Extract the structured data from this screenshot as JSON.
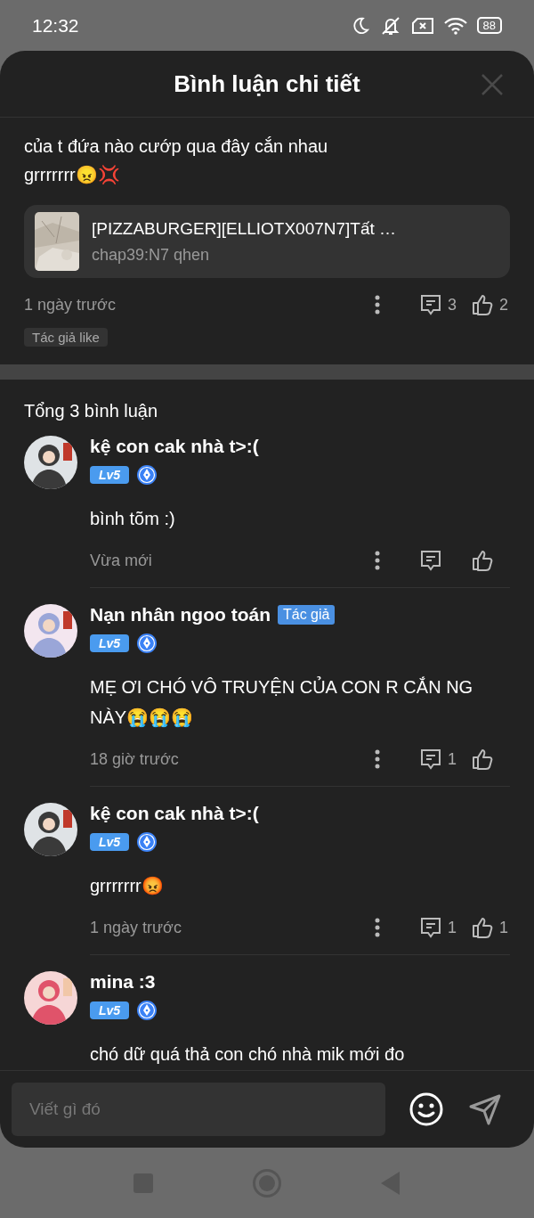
{
  "status_bar": {
    "time": "12:32",
    "battery": "88"
  },
  "header": {
    "title": "Bình luận chi tiết"
  },
  "post": {
    "text": "của t đứa nào cướp qua đây cắn nhau grrrrrrr😠💢",
    "story": {
      "title": "[PIZZABURGER][ELLIOTX007N7]Tất …",
      "chapter": "chap39:N7 qhen"
    },
    "time": "1 ngày trước",
    "reply_count": "3",
    "like_count": "2",
    "tag": "Tác giả like"
  },
  "total": "Tổng 3 bình luận",
  "comments": [
    {
      "name": "kệ con cak nhà t>:(",
      "level": "Lv5",
      "text": "bình tõm :)",
      "time": "Vừa mới"
    },
    {
      "name": "Nạn nhân ngoo toán",
      "author_tag": "Tác giả",
      "level": "Lv5",
      "text": "MẸ ƠI CHÓ VÔ TRUYỆN CỦA CON R CẮN NG NÀY😭😭😭",
      "time": "18 giờ trước",
      "reply_count": "1"
    },
    {
      "name": "kệ con cak nhà t>:(",
      "level": "Lv5",
      "text": "grrrrrrr😡",
      "time": "1 ngày trước",
      "reply_count": "1",
      "like_count": "1"
    },
    {
      "name": "mina :3",
      "level": "Lv5",
      "text": "chó dữ quá thả con chó nhà mik mới đo"
    }
  ],
  "composer": {
    "placeholder": "Viết gì đó"
  }
}
